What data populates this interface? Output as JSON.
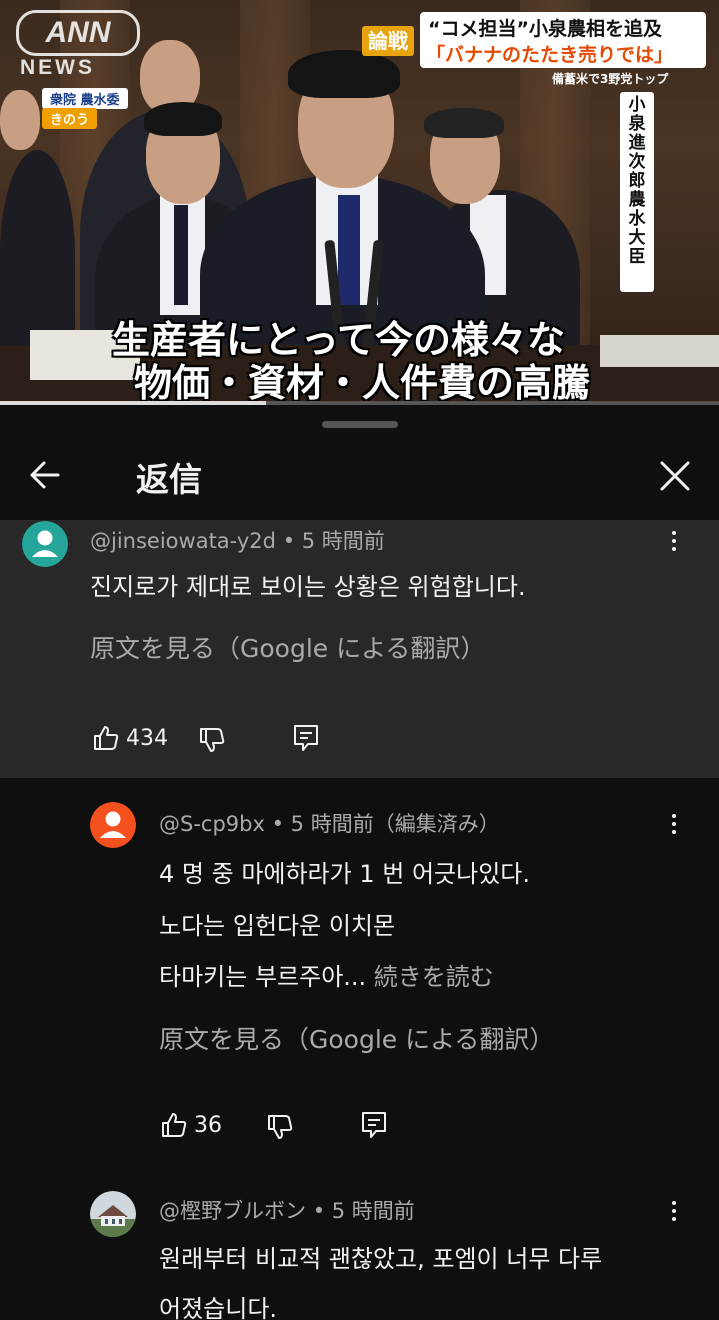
{
  "video": {
    "channel_logo_text": "ANN",
    "channel_logo_sub": "NEWS",
    "location_tag": "衆院 農水委",
    "day_tag": "きのう",
    "badge": "論戦",
    "headline_line1": "“コメ担当”小泉農相を追及",
    "headline_line2": "「バナナのたたき売りでは」",
    "subheadline": "備蓄米で3野党トップ",
    "speaker_nameplate": "小泉進次郎農水大臣",
    "caption_line1": "生産者にとって今の様々な",
    "caption_line2": "物価・資材・人件費の高騰",
    "progress_fraction": 0.37
  },
  "panel": {
    "title": "返信",
    "back_icon": "arrow-left-icon",
    "close_icon": "close-icon"
  },
  "comments": {
    "parent": {
      "author": "@jinseiowata-y2d",
      "time": "5 時間前",
      "lines": [
        "진지로가 제대로 보이는 상황은 위험합니다."
      ],
      "translate_label": "原文を見る（Google による翻訳）",
      "likes": "434",
      "avatar_color": "#26a69a"
    },
    "reply1": {
      "author": "@S-cp9bx",
      "time": "5 時間前（編集済み）",
      "lines": [
        "4 명 중 마에하라가 1 번 어긋나있다.",
        "노다는 입헌다운 이치몬",
        "타마키는 부르주아..."
      ],
      "more_label": "続きを読む",
      "translate_label": "原文を見る（Google による翻訳）",
      "likes": "36",
      "avatar_color": "#f4511e"
    },
    "reply2": {
      "author": "@樫野ブルボン",
      "time": "5 時間前",
      "lines": [
        "원래부터 비교적 괜찮았고, 포엠이 너무 다루",
        "어졌습니다."
      ]
    }
  }
}
